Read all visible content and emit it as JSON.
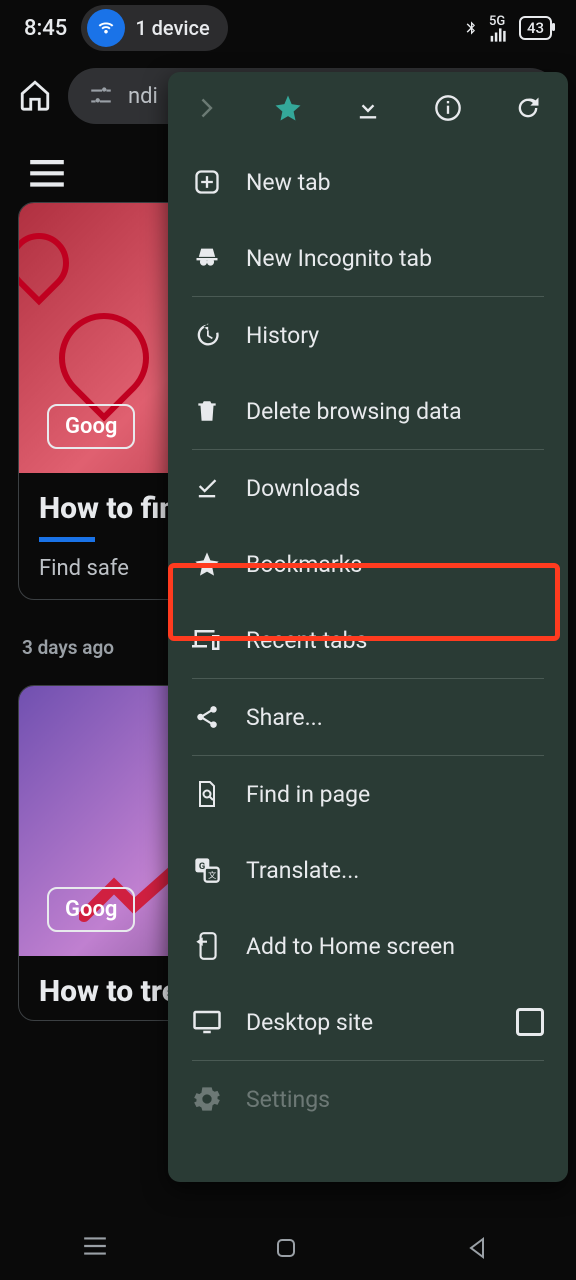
{
  "status": {
    "time": "8:45",
    "device_chip": "1 device",
    "network": "5G",
    "battery": "43"
  },
  "toolbar": {
    "omnibox_text": "ndi"
  },
  "page": {
    "cards": [
      {
        "chip": "Goog",
        "title": "How to find er",
        "subtitle": "Find safe",
        "meta": "3 days ago"
      },
      {
        "chip": "Goog",
        "title": "How to trending searches"
      }
    ]
  },
  "menu": {
    "items": [
      {
        "id": "new-tab",
        "label": "New tab"
      },
      {
        "id": "incognito",
        "label": "New Incognito tab"
      },
      {
        "id": "history",
        "label": "History"
      },
      {
        "id": "delete-data",
        "label": "Delete browsing data"
      },
      {
        "id": "downloads",
        "label": "Downloads"
      },
      {
        "id": "bookmarks",
        "label": "Bookmarks"
      },
      {
        "id": "recent-tabs",
        "label": "Recent tabs"
      },
      {
        "id": "share",
        "label": "Share..."
      },
      {
        "id": "find",
        "label": "Find in page"
      },
      {
        "id": "translate",
        "label": "Translate..."
      },
      {
        "id": "add-home",
        "label": "Add to Home screen"
      },
      {
        "id": "desktop",
        "label": "Desktop site"
      },
      {
        "id": "settings",
        "label": "Settings"
      }
    ]
  },
  "highlighted_item": "bookmarks"
}
